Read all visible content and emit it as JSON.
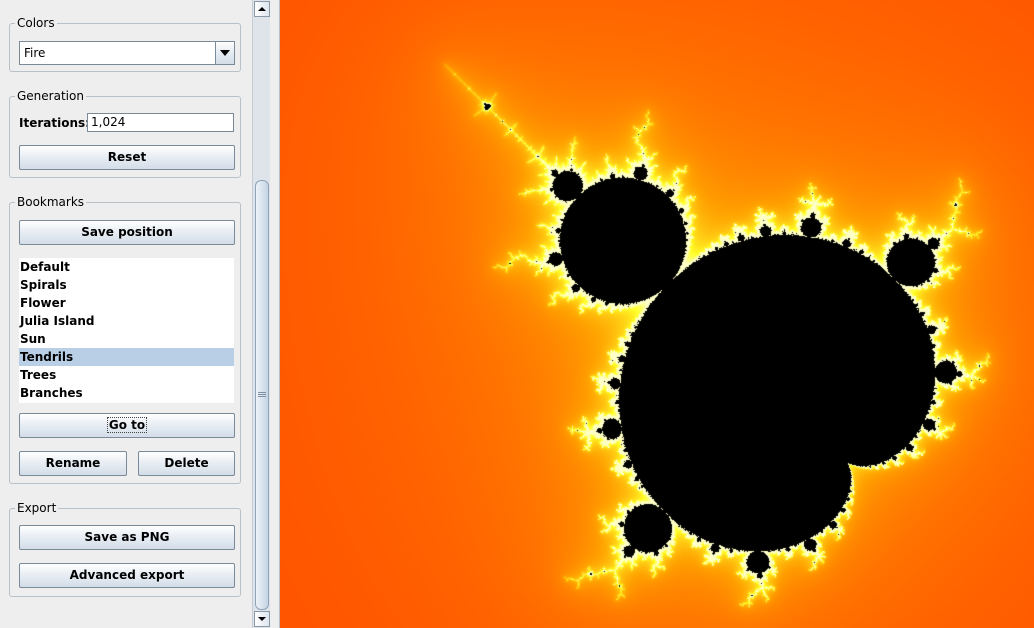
{
  "colors_group": {
    "title": "Colors",
    "selected_palette": "Fire"
  },
  "generation_group": {
    "title": "Generation",
    "iterations_label": "Iterations:",
    "iterations_value": "1,024",
    "reset_label": "Reset"
  },
  "bookmarks_group": {
    "title": "Bookmarks",
    "save_position_label": "Save position",
    "items": [
      "Default",
      "Spirals",
      "Flower",
      "Julia Island",
      "Sun",
      "Tendrils",
      "Trees",
      "Branches"
    ],
    "selected_item": "Tendrils",
    "goto_label": "Go to",
    "rename_label": "Rename",
    "delete_label": "Delete"
  },
  "export_group": {
    "title": "Export",
    "save_png_label": "Save as PNG",
    "advanced_export_label": "Advanced export"
  },
  "colors": {
    "panel_background": "#eeeeee",
    "selection": "#b8cfe5",
    "fractal_interior": "#000000",
    "fractal_outer": "#ff1a00",
    "fractal_mid": "#ffa000",
    "fractal_edge": "#ffff40"
  }
}
